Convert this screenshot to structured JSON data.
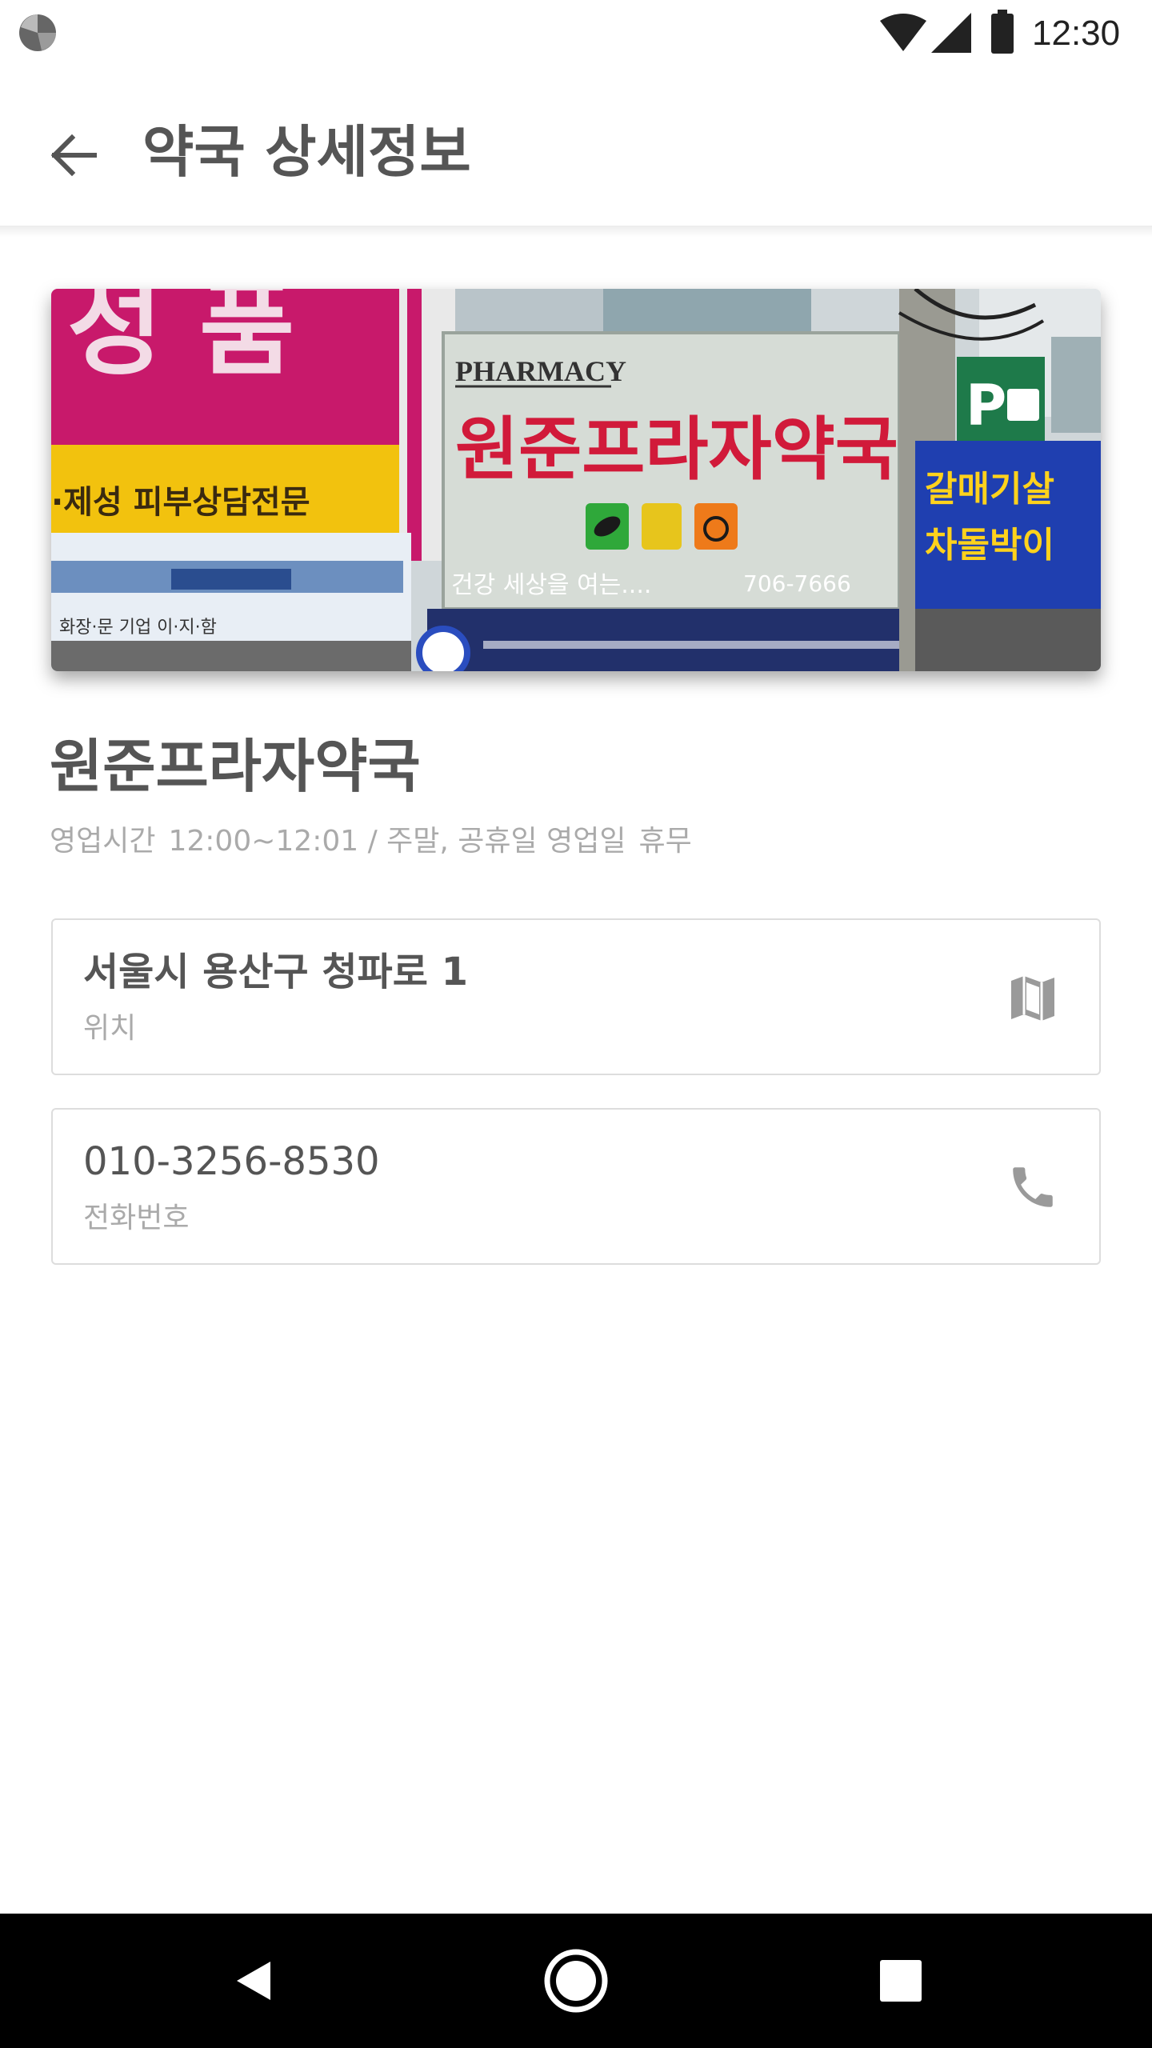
{
  "status_bar": {
    "time": "12:30",
    "icons": [
      "app-icon",
      "wifi-icon",
      "signal-icon",
      "battery-icon"
    ]
  },
  "app_bar": {
    "title": "약국 상세정보",
    "back_icon": "arrow-left-icon"
  },
  "hero_image": {
    "signs": {
      "left_big_text": "성 품",
      "left_strip_text": "·제성 피부상담전문",
      "left_lower_text": "화장·문 기업 이·지·함",
      "pharmacy_english": "PHARMACY",
      "pharmacy_korean": "원준프라자약국",
      "pharmacy_tagline": "건강 세상을 여는....",
      "pharmacy_phone": "706-7666",
      "parking_letter": "P",
      "right_sign_line1": "갈매기살",
      "right_sign_line2": "차돌박이"
    }
  },
  "pharmacy": {
    "name": "원준프라자약국",
    "hours_label": "영업시간",
    "hours_value": "12:00~12:01 / 주말, 공휴일 영업일",
    "holiday": "휴무"
  },
  "address_card": {
    "value": "서울시 용산구 청파로 1",
    "label": "위치",
    "icon": "map-icon"
  },
  "phone_card": {
    "value": "010-3256-8530",
    "label": "전화번호",
    "icon": "phone-icon"
  },
  "nav_bar": {
    "icons": [
      "back-triangle-icon",
      "home-circle-icon",
      "recents-square-icon"
    ]
  },
  "colors": {
    "title_text": "#555555",
    "secondary_text": "#aaaaaa",
    "card_border": "#dddddd",
    "nav_background": "#000000"
  }
}
